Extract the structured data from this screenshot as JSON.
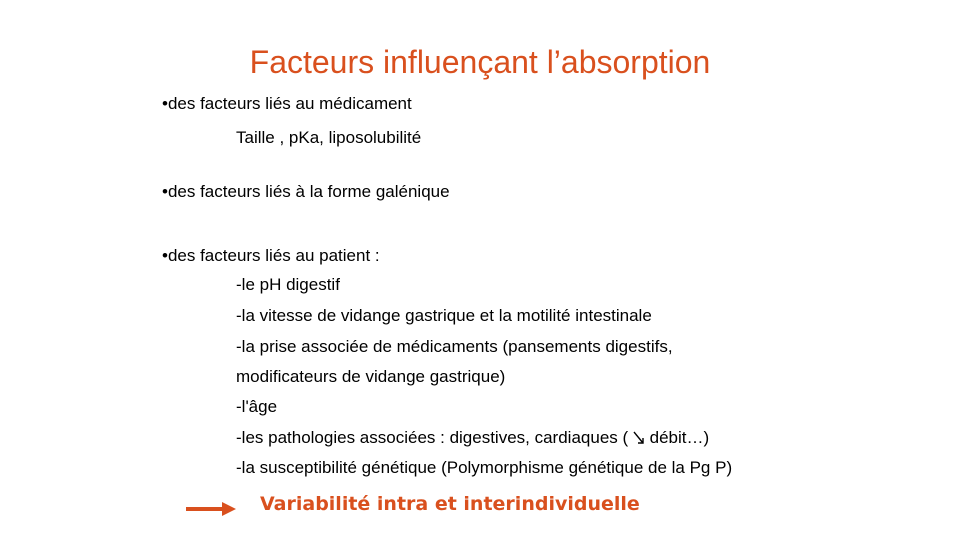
{
  "slide": {
    "title": "Facteurs influençant l’absorption",
    "items": [
      {
        "bullet": "•des facteurs liés au médicament",
        "details": [
          "Taille , pKa, liposolubilité"
        ]
      },
      {
        "bullet": "•des facteurs liés à la forme galénique",
        "details": []
      },
      {
        "bullet": "•des facteurs liés au patient :",
        "details": [
          "-le pH digestif",
          "-la vitesse de vidange gastrique et la motilité intestinale",
          "-la prise associée de médicaments (pansements digestifs,",
          "modificateurs de vidange gastrique)",
          "-l'âge",
          "-les pathologies associées : digestives, cardiaques (",
          "-la susceptibilité génétique (Polymorphisme génétique de la Pg P)"
        ],
        "cardiac_suffix": "débit…)"
      }
    ],
    "conclusion": "Variabilité intra et interindividuelle",
    "colors": {
      "accent": "#d9501e",
      "text": "#000000",
      "background": "#ffffff"
    },
    "icons": {
      "conclusion_arrow": "right-arrow-icon",
      "decrease_arrow": "down-right-arrow-icon"
    }
  }
}
